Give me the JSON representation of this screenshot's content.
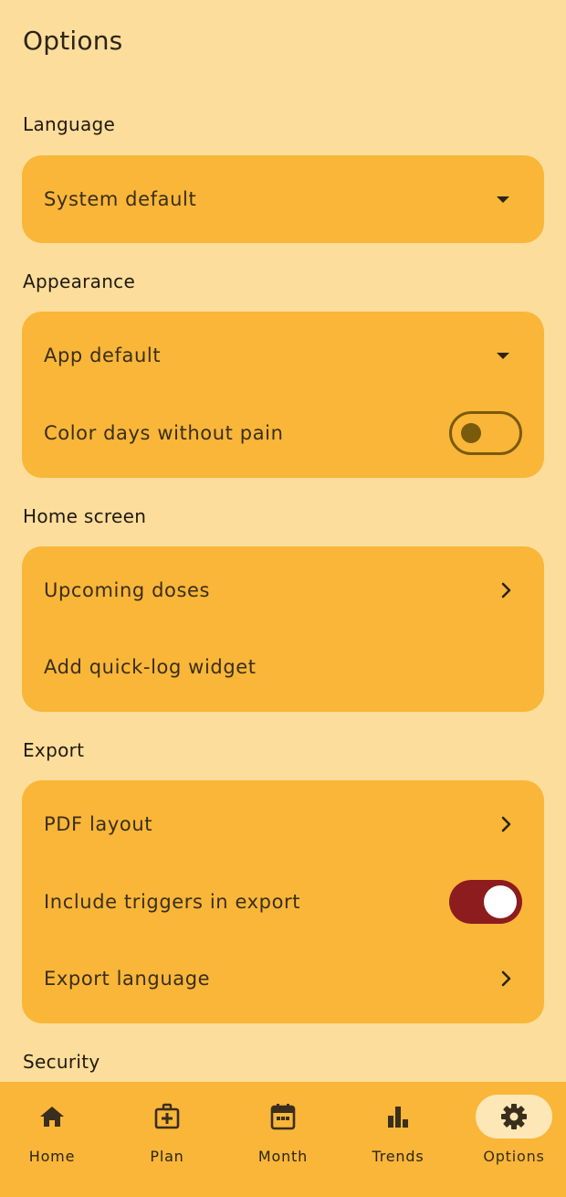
{
  "header": {
    "title": "Options"
  },
  "sections": {
    "language": {
      "title": "Language",
      "rows": {
        "language": {
          "label": "System default"
        }
      }
    },
    "appearance": {
      "title": "Appearance",
      "rows": {
        "theme": {
          "label": "App default"
        },
        "color_days": {
          "label": "Color days without pain",
          "enabled": false
        }
      }
    },
    "home_screen": {
      "title": "Home screen",
      "rows": {
        "upcoming_doses": {
          "label": "Upcoming doses"
        },
        "quick_log": {
          "label": "Add quick-log widget"
        }
      }
    },
    "export": {
      "title": "Export",
      "rows": {
        "pdf_layout": {
          "label": "PDF layout"
        },
        "include_triggers": {
          "label": "Include triggers in export",
          "enabled": true
        },
        "export_language": {
          "label": "Export language"
        }
      }
    },
    "security": {
      "title": "Security"
    }
  },
  "bottom_nav": {
    "items": [
      {
        "label": "Home",
        "icon": "home-icon"
      },
      {
        "label": "Plan",
        "icon": "medical-kit-icon"
      },
      {
        "label": "Month",
        "icon": "calendar-icon"
      },
      {
        "label": "Trends",
        "icon": "bar-chart-icon"
      },
      {
        "label": "Options",
        "icon": "gear-icon"
      }
    ],
    "active": "Options"
  },
  "colors": {
    "background": "#FDDD9B",
    "card": "#F9B638",
    "toggle_on": "#8C1C1E",
    "toggle_off_outline": "#7A5A0C",
    "nav_active_pill": "#FDE7B6"
  }
}
